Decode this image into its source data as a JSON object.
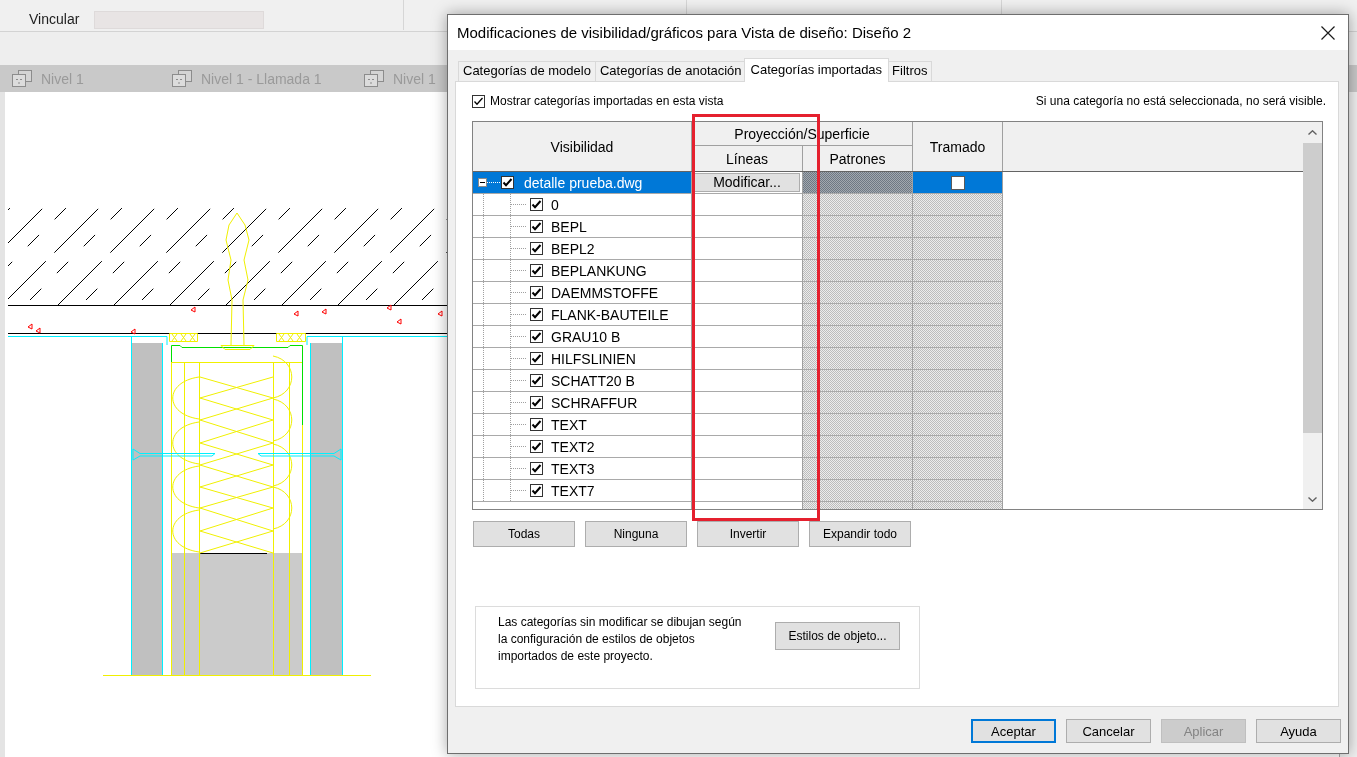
{
  "app": {
    "link_label": "Vincular",
    "view_tabs": [
      "Nivel 1",
      "Nivel 1 - Llamada 1",
      "Nivel 1"
    ]
  },
  "dialog": {
    "title": "Modificaciones de visibilidad/gráficos para Vista de diseño: Diseño 2",
    "tabs": [
      {
        "label": "Categorías de modelo",
        "selected": false
      },
      {
        "label": "Categorías de anotación",
        "selected": false
      },
      {
        "label": "Categorías importadas",
        "selected": true
      },
      {
        "label": "Filtros",
        "selected": false
      }
    ],
    "show_imported": {
      "label": "Mostrar categorías importadas en esta vista",
      "checked": true
    },
    "hint": "Si una categoría no está seleccionada, no será visible.",
    "table": {
      "headers": {
        "visibility": "Visibilidad",
        "projection_surface": "Proyección/Superficie",
        "lines": "Líneas",
        "patterns": "Patrones",
        "halftone": "Tramado"
      },
      "rows": [
        {
          "name": "detalle prueba.dwg",
          "checked": true,
          "expanded": true,
          "selected": true,
          "lines_button": "Modificar...",
          "halftone_checked": false,
          "children": [
            {
              "name": "0",
              "checked": true,
              "selected": false
            },
            {
              "name": "BEPL",
              "checked": true,
              "selected": false
            },
            {
              "name": "BEPL2",
              "checked": true,
              "selected": false
            },
            {
              "name": "BEPLANKUNG",
              "checked": true,
              "selected": false
            },
            {
              "name": "DAEMMSTOFFE",
              "checked": true,
              "selected": false
            },
            {
              "name": "FLANK-BAUTEILE",
              "checked": true,
              "selected": false
            },
            {
              "name": "GRAU10 B",
              "checked": true,
              "selected": false
            },
            {
              "name": "HILFSLINIEN",
              "checked": true,
              "selected": false
            },
            {
              "name": "SCHATT20 B",
              "checked": true,
              "selected": false
            },
            {
              "name": "SCHRAFFUR",
              "checked": true,
              "selected": false
            },
            {
              "name": "TEXT",
              "checked": true,
              "selected": false
            },
            {
              "name": "TEXT2",
              "checked": true,
              "selected": false
            },
            {
              "name": "TEXT3",
              "checked": true,
              "selected": false
            },
            {
              "name": "TEXT7",
              "checked": true,
              "selected": false
            }
          ]
        }
      ]
    },
    "table_buttons": [
      "Todas",
      "Ninguna",
      "Invertir",
      "Expandir todo"
    ],
    "info": {
      "text": "Las categorías sin modificar se dibujan según la configuración de estilos de objetos importados de este proyecto.",
      "button": "Estilos de objeto..."
    },
    "buttons": [
      {
        "label": "Aceptar",
        "default": true,
        "disabled": false
      },
      {
        "label": "Cancelar",
        "default": false,
        "disabled": false
      },
      {
        "label": "Aplicar",
        "default": false,
        "disabled": true
      },
      {
        "label": "Ayuda",
        "default": false,
        "disabled": false
      }
    ]
  }
}
